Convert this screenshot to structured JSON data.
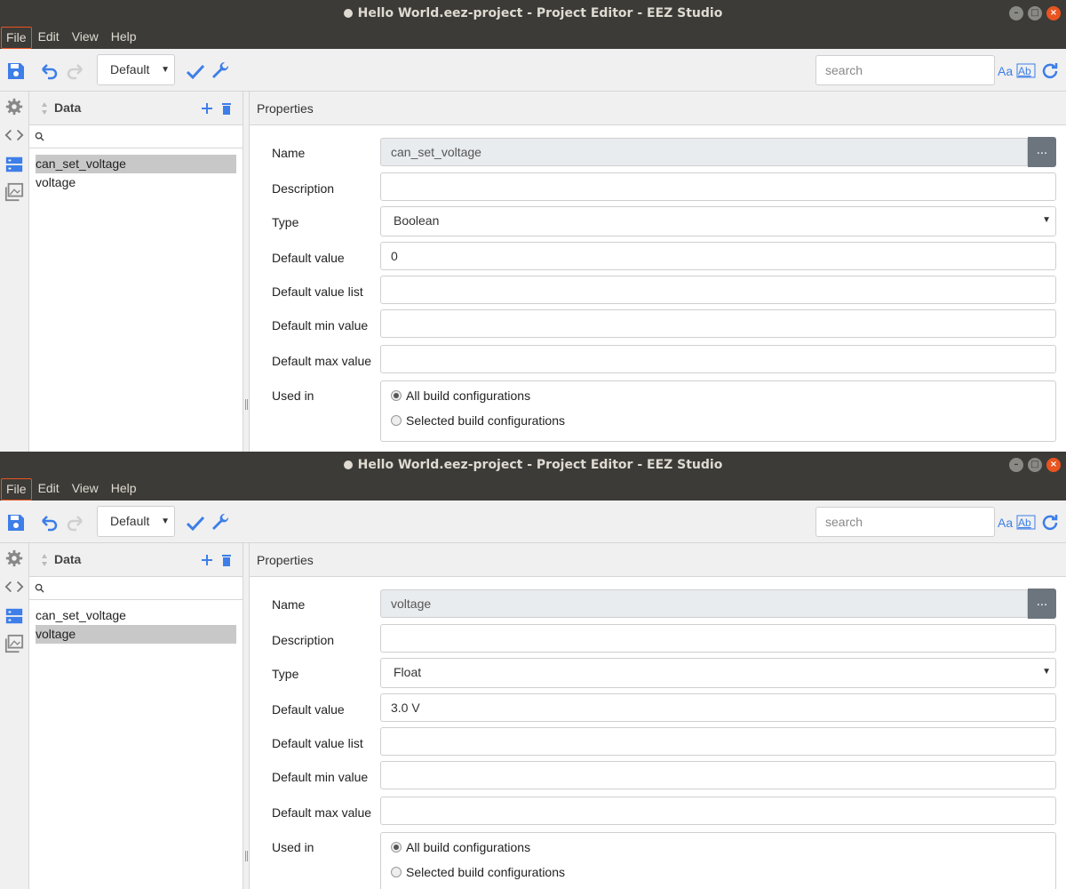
{
  "window_title": "Hello World.eez-project - Project Editor - EEZ Studio",
  "menu": [
    "File",
    "Edit",
    "View",
    "Help"
  ],
  "toolbar": {
    "configuration": "Default",
    "search_placeholder": "search"
  },
  "left_panel": {
    "title": "Data",
    "items": [
      "can_set_voltage",
      "voltage"
    ]
  },
  "properties_title": "Properties",
  "labels": {
    "name": "Name",
    "description": "Description",
    "type": "Type",
    "default_value": "Default value",
    "default_value_list": "Default value list",
    "default_min_value": "Default min value",
    "default_max_value": "Default max value",
    "used_in": "Used in",
    "all_build_configurations": "All build configurations",
    "selected_build_configurations": "Selected build configurations",
    "dots": "..."
  },
  "windows": [
    {
      "selected_item": "can_set_voltage",
      "name": "can_set_voltage",
      "description": "",
      "type": "Boolean",
      "default_value": "0",
      "default_value_list": "",
      "default_min_value": "",
      "default_max_value": "",
      "used_in": "All build configurations"
    },
    {
      "selected_item": "voltage",
      "name": "voltage",
      "description": "",
      "type": "Float",
      "default_value": "3.0 V",
      "default_value_list": "",
      "default_min_value": "",
      "default_max_value": "",
      "used_in": "All build configurations"
    }
  ],
  "colors": {
    "title_bar": "#3c3b37",
    "accent_blue": "#3d7ee8",
    "close_button": "#e95420",
    "selected_row": "#c8c8c8"
  }
}
